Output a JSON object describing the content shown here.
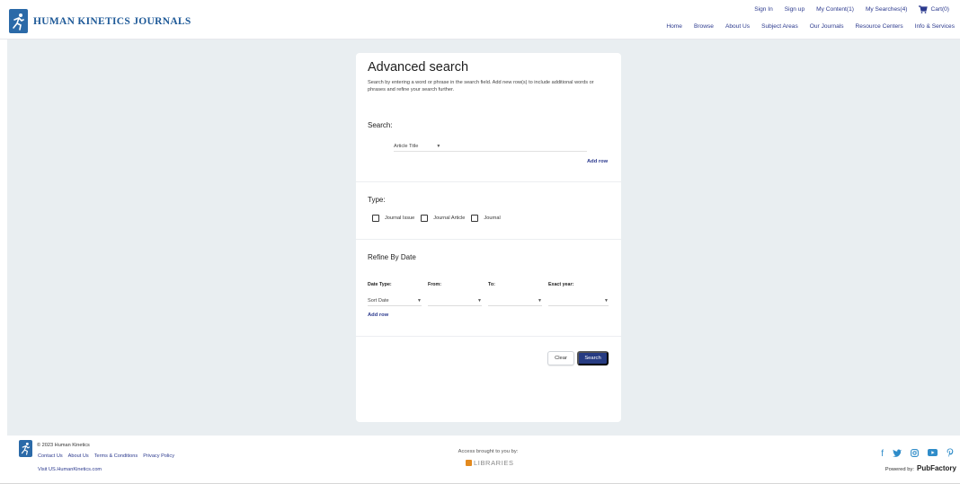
{
  "header": {
    "logo_text": "HUMAN KINETICS JOURNALS",
    "util_nav": {
      "sign_in": "Sign In",
      "sign_up": "Sign up",
      "my_content": "My Content(1)",
      "my_searches": "My Searches(4)",
      "cart": "Cart(0)"
    },
    "main_nav": [
      "Home",
      "Browse",
      "About Us",
      "Subject Areas",
      "Our Journals",
      "Resource Centers",
      "Info & Services"
    ]
  },
  "card": {
    "title": "Advanced search",
    "intro": "Search by entering a word or phrase in the search field. Add new row(s) to include additional words or phrases and refine your search further.",
    "search_label": "Search:",
    "field_select": "Article Title",
    "add_row": "Add row",
    "type_label": "Type:",
    "types": [
      "Journal Issue",
      "Journal Article",
      "Journal"
    ],
    "refine_label": "Refine By Date",
    "date_headers": [
      "Date Type:",
      "From:",
      "To:",
      "Exact year:"
    ],
    "date_type_value": "Sort Date",
    "date_add_row": "Add row",
    "clear_label": "Clear",
    "search_button": "Search"
  },
  "footer": {
    "copyright": "© 2023 Human Kinetics",
    "links": [
      "Contact Us",
      "About Us",
      "Terms & Conditions",
      "Privacy Policy"
    ],
    "visit": "Visit US.HumanKinetics.com",
    "access": "Access brought to you by:",
    "library": "LIBRARIES",
    "powered_by": "Powered by:",
    "pubfactory": "PubFactory"
  },
  "colors": {
    "brand_blue": "#2b6aa8",
    "link_navy": "#2c3a8e",
    "button_navy": "#263b82",
    "page_bg": "#e9eef1",
    "social_blue": "#2f8cc9"
  }
}
